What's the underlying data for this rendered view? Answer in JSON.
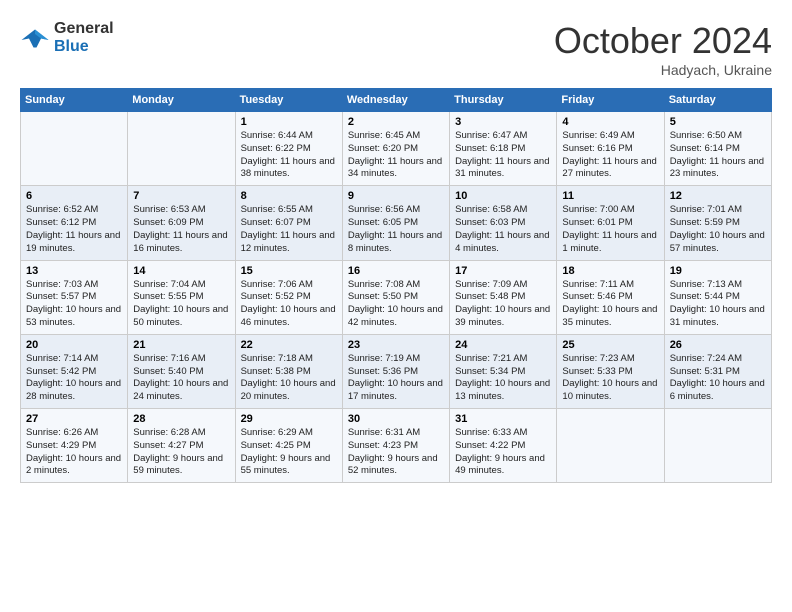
{
  "header": {
    "logo_line1": "General",
    "logo_line2": "Blue",
    "month": "October 2024",
    "location": "Hadyach, Ukraine"
  },
  "weekdays": [
    "Sunday",
    "Monday",
    "Tuesday",
    "Wednesday",
    "Thursday",
    "Friday",
    "Saturday"
  ],
  "weeks": [
    [
      {
        "day": "",
        "info": ""
      },
      {
        "day": "",
        "info": ""
      },
      {
        "day": "1",
        "info": "Sunrise: 6:44 AM\nSunset: 6:22 PM\nDaylight: 11 hours and 38 minutes."
      },
      {
        "day": "2",
        "info": "Sunrise: 6:45 AM\nSunset: 6:20 PM\nDaylight: 11 hours and 34 minutes."
      },
      {
        "day": "3",
        "info": "Sunrise: 6:47 AM\nSunset: 6:18 PM\nDaylight: 11 hours and 31 minutes."
      },
      {
        "day": "4",
        "info": "Sunrise: 6:49 AM\nSunset: 6:16 PM\nDaylight: 11 hours and 27 minutes."
      },
      {
        "day": "5",
        "info": "Sunrise: 6:50 AM\nSunset: 6:14 PM\nDaylight: 11 hours and 23 minutes."
      }
    ],
    [
      {
        "day": "6",
        "info": "Sunrise: 6:52 AM\nSunset: 6:12 PM\nDaylight: 11 hours and 19 minutes."
      },
      {
        "day": "7",
        "info": "Sunrise: 6:53 AM\nSunset: 6:09 PM\nDaylight: 11 hours and 16 minutes."
      },
      {
        "day": "8",
        "info": "Sunrise: 6:55 AM\nSunset: 6:07 PM\nDaylight: 11 hours and 12 minutes."
      },
      {
        "day": "9",
        "info": "Sunrise: 6:56 AM\nSunset: 6:05 PM\nDaylight: 11 hours and 8 minutes."
      },
      {
        "day": "10",
        "info": "Sunrise: 6:58 AM\nSunset: 6:03 PM\nDaylight: 11 hours and 4 minutes."
      },
      {
        "day": "11",
        "info": "Sunrise: 7:00 AM\nSunset: 6:01 PM\nDaylight: 11 hours and 1 minute."
      },
      {
        "day": "12",
        "info": "Sunrise: 7:01 AM\nSunset: 5:59 PM\nDaylight: 10 hours and 57 minutes."
      }
    ],
    [
      {
        "day": "13",
        "info": "Sunrise: 7:03 AM\nSunset: 5:57 PM\nDaylight: 10 hours and 53 minutes."
      },
      {
        "day": "14",
        "info": "Sunrise: 7:04 AM\nSunset: 5:55 PM\nDaylight: 10 hours and 50 minutes."
      },
      {
        "day": "15",
        "info": "Sunrise: 7:06 AM\nSunset: 5:52 PM\nDaylight: 10 hours and 46 minutes."
      },
      {
        "day": "16",
        "info": "Sunrise: 7:08 AM\nSunset: 5:50 PM\nDaylight: 10 hours and 42 minutes."
      },
      {
        "day": "17",
        "info": "Sunrise: 7:09 AM\nSunset: 5:48 PM\nDaylight: 10 hours and 39 minutes."
      },
      {
        "day": "18",
        "info": "Sunrise: 7:11 AM\nSunset: 5:46 PM\nDaylight: 10 hours and 35 minutes."
      },
      {
        "day": "19",
        "info": "Sunrise: 7:13 AM\nSunset: 5:44 PM\nDaylight: 10 hours and 31 minutes."
      }
    ],
    [
      {
        "day": "20",
        "info": "Sunrise: 7:14 AM\nSunset: 5:42 PM\nDaylight: 10 hours and 28 minutes."
      },
      {
        "day": "21",
        "info": "Sunrise: 7:16 AM\nSunset: 5:40 PM\nDaylight: 10 hours and 24 minutes."
      },
      {
        "day": "22",
        "info": "Sunrise: 7:18 AM\nSunset: 5:38 PM\nDaylight: 10 hours and 20 minutes."
      },
      {
        "day": "23",
        "info": "Sunrise: 7:19 AM\nSunset: 5:36 PM\nDaylight: 10 hours and 17 minutes."
      },
      {
        "day": "24",
        "info": "Sunrise: 7:21 AM\nSunset: 5:34 PM\nDaylight: 10 hours and 13 minutes."
      },
      {
        "day": "25",
        "info": "Sunrise: 7:23 AM\nSunset: 5:33 PM\nDaylight: 10 hours and 10 minutes."
      },
      {
        "day": "26",
        "info": "Sunrise: 7:24 AM\nSunset: 5:31 PM\nDaylight: 10 hours and 6 minutes."
      }
    ],
    [
      {
        "day": "27",
        "info": "Sunrise: 6:26 AM\nSunset: 4:29 PM\nDaylight: 10 hours and 2 minutes."
      },
      {
        "day": "28",
        "info": "Sunrise: 6:28 AM\nSunset: 4:27 PM\nDaylight: 9 hours and 59 minutes."
      },
      {
        "day": "29",
        "info": "Sunrise: 6:29 AM\nSunset: 4:25 PM\nDaylight: 9 hours and 55 minutes."
      },
      {
        "day": "30",
        "info": "Sunrise: 6:31 AM\nSunset: 4:23 PM\nDaylight: 9 hours and 52 minutes."
      },
      {
        "day": "31",
        "info": "Sunrise: 6:33 AM\nSunset: 4:22 PM\nDaylight: 9 hours and 49 minutes."
      },
      {
        "day": "",
        "info": ""
      },
      {
        "day": "",
        "info": ""
      }
    ]
  ]
}
